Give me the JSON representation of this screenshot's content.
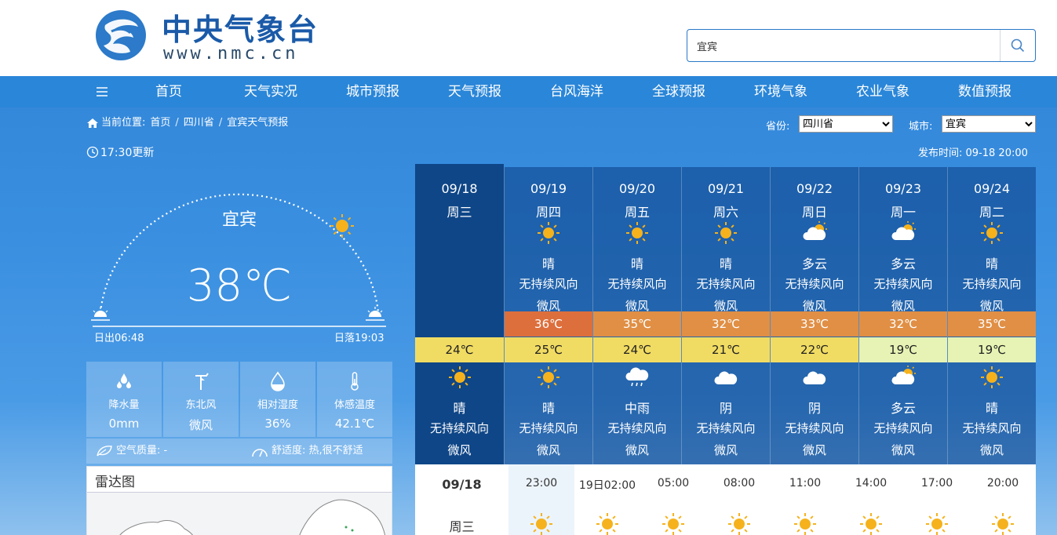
{
  "header": {
    "logo_title": "中央气象台",
    "logo_url": "www.nmc.cn",
    "search_value": "宜宾"
  },
  "nav": {
    "items": [
      "首页",
      "天气实况",
      "城市预报",
      "天气预报",
      "台风海洋",
      "全球预报",
      "环境气象",
      "农业气象",
      "数值预报"
    ]
  },
  "breadcrumb": {
    "label": "当前位置:",
    "items": [
      "首页",
      "四川省",
      "宜宾天气预报"
    ]
  },
  "selectors": {
    "province_label": "省份:",
    "province_value": "四川省",
    "city_label": "城市:",
    "city_value": "宜宾"
  },
  "update_time": "17:30更新",
  "publish_time": "发布时间: 09-18 20:00",
  "current": {
    "city": "宜宾",
    "temperature": "38℃",
    "sunrise": "日出06:48",
    "sunset": "日落19:03"
  },
  "stats": [
    {
      "icon": "raindrops-icon",
      "label": "降水量",
      "value": "0mm"
    },
    {
      "icon": "wind-icon",
      "label": "东北风",
      "value": "微风"
    },
    {
      "icon": "humidity-icon",
      "label": "相对湿度",
      "value": "36%"
    },
    {
      "icon": "thermometer-icon",
      "label": "体感温度",
      "value": "42.1℃"
    }
  ],
  "air_quality": "空气质量: -",
  "comfort": "舒适度: 热,很不舒适",
  "radar_title": "雷达图",
  "forecast": [
    {
      "date": "09/18",
      "week": "周三",
      "day": null,
      "high": null,
      "low": "24℃",
      "night": {
        "desc": "晴",
        "wind_dir": "无持续风向",
        "wind_speed": "微风",
        "icon": "sun-icon"
      }
    },
    {
      "date": "09/19",
      "week": "周四",
      "day": {
        "desc": "晴",
        "wind_dir": "无持续风向",
        "wind_speed": "微风",
        "icon": "sun-icon"
      },
      "high": "36℃",
      "low": "25℃",
      "night": {
        "desc": "晴",
        "wind_dir": "无持续风向",
        "wind_speed": "微风",
        "icon": "sun-icon"
      }
    },
    {
      "date": "09/20",
      "week": "周五",
      "day": {
        "desc": "晴",
        "wind_dir": "无持续风向",
        "wind_speed": "微风",
        "icon": "sun-icon"
      },
      "high": "35℃",
      "low": "24℃",
      "night": {
        "desc": "中雨",
        "wind_dir": "无持续风向",
        "wind_speed": "微风",
        "icon": "rain-cloud-icon"
      }
    },
    {
      "date": "09/21",
      "week": "周六",
      "day": {
        "desc": "晴",
        "wind_dir": "无持续风向",
        "wind_speed": "微风",
        "icon": "sun-icon"
      },
      "high": "32℃",
      "low": "21℃",
      "night": {
        "desc": "阴",
        "wind_dir": "无持续风向",
        "wind_speed": "微风",
        "icon": "cloud-icon"
      }
    },
    {
      "date": "09/22",
      "week": "周日",
      "day": {
        "desc": "多云",
        "wind_dir": "无持续风向",
        "wind_speed": "微风",
        "icon": "partly-cloudy-icon"
      },
      "high": "33℃",
      "low": "22℃",
      "night": {
        "desc": "阴",
        "wind_dir": "无持续风向",
        "wind_speed": "微风",
        "icon": "cloud-icon"
      }
    },
    {
      "date": "09/23",
      "week": "周一",
      "day": {
        "desc": "多云",
        "wind_dir": "无持续风向",
        "wind_speed": "微风",
        "icon": "partly-cloudy-icon"
      },
      "high": "32℃",
      "low": "19℃",
      "night": {
        "desc": "多云",
        "wind_dir": "无持续风向",
        "wind_speed": "微风",
        "icon": "partly-cloudy-icon"
      }
    },
    {
      "date": "09/24",
      "week": "周二",
      "day": {
        "desc": "晴",
        "wind_dir": "无持续风向",
        "wind_speed": "微风",
        "icon": "sun-icon"
      },
      "high": "35℃",
      "low": "19℃",
      "night": {
        "desc": "晴",
        "wind_dir": "无持续风向",
        "wind_speed": "微风",
        "icon": "sun-icon"
      }
    }
  ],
  "colors": {
    "high": [
      "#dd6f3c",
      "#e08f45",
      "#e08f45",
      "#e08f45",
      "#e08f45",
      "#e08f45"
    ],
    "low": [
      "#f1dc63",
      "#f1dc63",
      "#f1dc63",
      "#f1dc63",
      "#f1dc63",
      "#e6f3b4",
      "#e6f3b4"
    ]
  },
  "hourly": {
    "date": "09/18",
    "week": "周三",
    "times": [
      "23:00",
      "19日02:00",
      "05:00",
      "08:00",
      "11:00",
      "14:00",
      "17:00",
      "20:00"
    ]
  }
}
